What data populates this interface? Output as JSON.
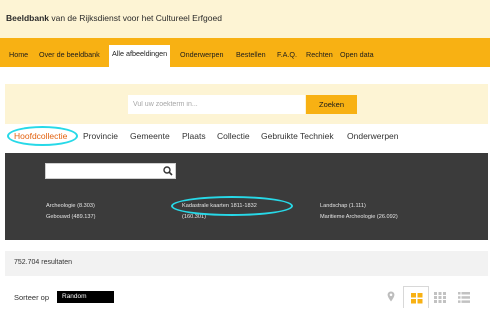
{
  "header": {
    "brand": "Beeldbank",
    "subtitle": " van de Rijksdienst voor het Cultureel Erfgoed"
  },
  "nav": {
    "items": [
      {
        "label": "Home"
      },
      {
        "label": "Over de beeldbank"
      },
      {
        "label": "Alle afbeeldingen",
        "active": true
      },
      {
        "label": "Onderwerpen"
      },
      {
        "label": "Bestellen"
      },
      {
        "label": "F.A.Q."
      },
      {
        "label": "Rechten"
      },
      {
        "label": "Open data"
      }
    ]
  },
  "search": {
    "placeholder": "Vul uw zoekterm in...",
    "button_label": "Zoeken"
  },
  "tabs": [
    {
      "label": "Hoofdcollectie",
      "active": true
    },
    {
      "label": "Provincie"
    },
    {
      "label": "Gemeente"
    },
    {
      "label": "Plaats"
    },
    {
      "label": "Collectie"
    },
    {
      "label": "Gebruikte Techniek"
    },
    {
      "label": "Onderwerpen"
    }
  ],
  "facets": {
    "filter_icon": "search-icon",
    "items": [
      {
        "label": "Archeologie (8.303)"
      },
      {
        "label": "Gebouwd (489.137)"
      },
      {
        "label": "Kadastrale kaarten 1811-1832"
      },
      {
        "label": "(160.301)"
      },
      {
        "label": "Landschap (1.111)"
      },
      {
        "label": "Maritieme Archeologie (26.092)"
      }
    ]
  },
  "results": {
    "count_label": "752.704 resultaten"
  },
  "sort": {
    "label": "Sorteer op",
    "selected": "Random"
  },
  "view_controls": {
    "icons": [
      "map-pin-icon",
      "grid-view-icon",
      "gallery-view-icon",
      "list-view-icon"
    ],
    "active": "grid-view-icon"
  },
  "colors": {
    "accent": "#f8b113",
    "band": "#fdf4d4",
    "panel": "#3b3b3b",
    "active_tab": "#e2610f",
    "annotation": "#27d9e8"
  }
}
